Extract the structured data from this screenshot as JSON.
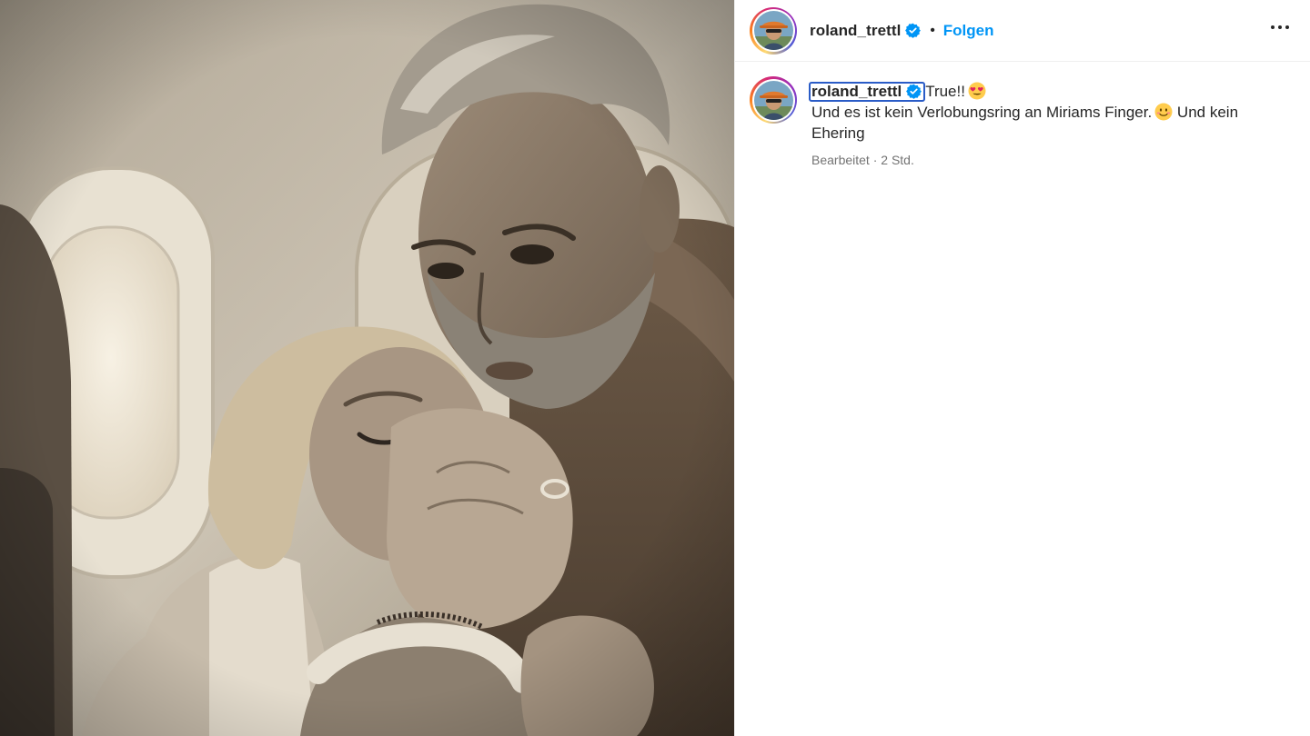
{
  "header": {
    "username": "roland_trettl",
    "separator": "•",
    "follow_label": "Folgen",
    "more_icon": "more-horizontal-icon"
  },
  "caption": {
    "username": "roland_trettl",
    "first_text": "True!!",
    "first_emoji": "heart-eyes-emoji",
    "second_text": "Und es ist kein Verlobungsring an Miriams Finger.",
    "second_emoji": "smiling-face-emoji",
    "third_text": "Und kein Ehering",
    "edited_label": "Bearbeitet · 2 Std."
  },
  "colors": {
    "accent_blue": "#0095f6",
    "verified_blue": "#0095f6",
    "text": "#262626",
    "muted": "#737373",
    "photo_tone": "sepia"
  }
}
